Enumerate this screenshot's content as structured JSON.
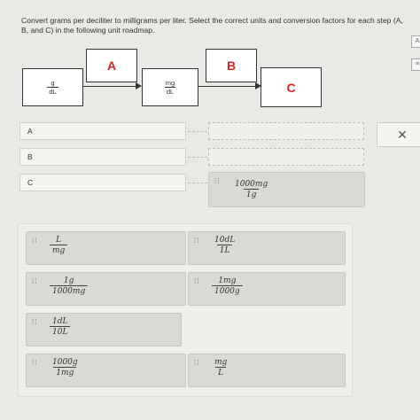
{
  "instructions": "Convert grams per deciliter to milligrams per liter. Select the correct units and conversion factors for each step (A, B, and C) in the following unit roadmap.",
  "roadmap": {
    "start": {
      "num": "g",
      "den": "dL"
    },
    "middle": {
      "num": "mg",
      "den": "dL"
    },
    "labels": {
      "a": "A",
      "b": "B",
      "c": "C"
    }
  },
  "rows": {
    "a": "A",
    "b": "B",
    "c": "C"
  },
  "placed_c": {
    "num": "1000mg",
    "den": "1g"
  },
  "close_label": "✕",
  "side_icons": {
    "top": "A",
    "bottom": "≡"
  },
  "tiles": [
    {
      "num": "L",
      "den": "mg"
    },
    {
      "num": "10dL",
      "den": "1L"
    },
    {
      "num": "1g",
      "den": "1000mg"
    },
    {
      "num": "1mg",
      "den": "1000g"
    },
    {
      "num": "1dL",
      "den": "10L"
    },
    {
      "num": "1000g",
      "den": "1mg"
    },
    {
      "num": "mg",
      "den": "L"
    }
  ],
  "grip_glyph": "⁞⁞"
}
